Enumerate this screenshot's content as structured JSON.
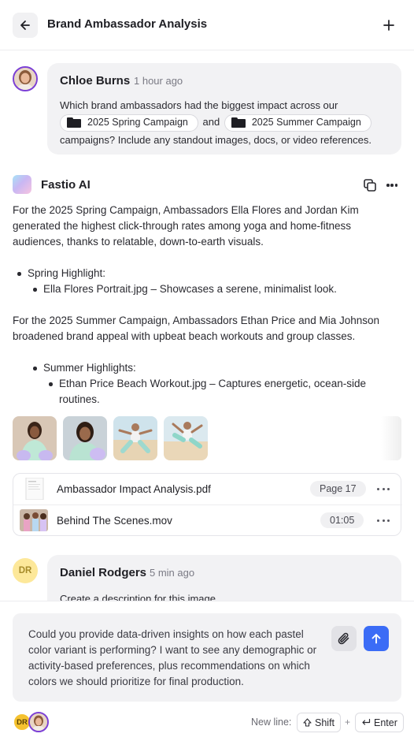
{
  "header": {
    "title": "Brand Ambassador Analysis"
  },
  "user_message": {
    "name": "Chloe Burns",
    "time": "1 hour ago",
    "text_before": "Which brand ambassadors had the biggest impact across our",
    "chip1": "2025 Spring Campaign",
    "text_mid": "and",
    "chip2": "2025 Summer Campaign",
    "text_after": "campaigns? Include any standout images, docs, or video references."
  },
  "ai_message": {
    "name": "Fastio AI",
    "para1": "For the 2025 Spring Campaign, Ambassadors Ella Flores and Jordan Kim generated the highest click-through rates among yoga and home-fitness audiences, thanks to relatable, down-to-earth visuals.",
    "spring_heading": "Spring Highlight:",
    "spring_item": "Ella Flores Portrait.jpg – Showcases a serene, minimalist look.",
    "para2": "For the 2025 Summer Campaign, Ambassadors Ethan Price and Mia Johnson broadened brand appeal with upbeat beach workouts and group classes.",
    "summer_heading": "Summer Highlights:",
    "summer_item": "Ethan Price Beach Workout.jpg – Captures energetic, ocean-side routines."
  },
  "files": [
    {
      "name": "Ambassador Impact Analysis.pdf",
      "badge": "Page 17"
    },
    {
      "name": "Behind The Scenes.mov",
      "badge": "01:05"
    }
  ],
  "second_message": {
    "initials": "DR",
    "name": "Daniel Rodgers",
    "time": "5 min ago",
    "text": "Create a description for this image"
  },
  "composer": {
    "text": "Could you provide data-driven insights on how each pastel color variant is performing? I want to see any demographic or activity-based preferences, plus recommendations on which colors we should prioritize for final production.",
    "presence_initials": "DR",
    "newline_label": "New line:",
    "shift_key": "Shift",
    "plus": "+",
    "enter_key": "Enter"
  },
  "colors": {
    "accent_blue": "#3b6cf6",
    "avatar_ring": "#7b3fd6",
    "bubble_bg": "#f2f2f4"
  },
  "icons": [
    "arrow-left-icon",
    "plus-icon",
    "folder-icon",
    "copy-icon",
    "more-dots-icon",
    "paperclip-icon",
    "arrow-up-icon",
    "shift-icon",
    "enter-icon"
  ]
}
